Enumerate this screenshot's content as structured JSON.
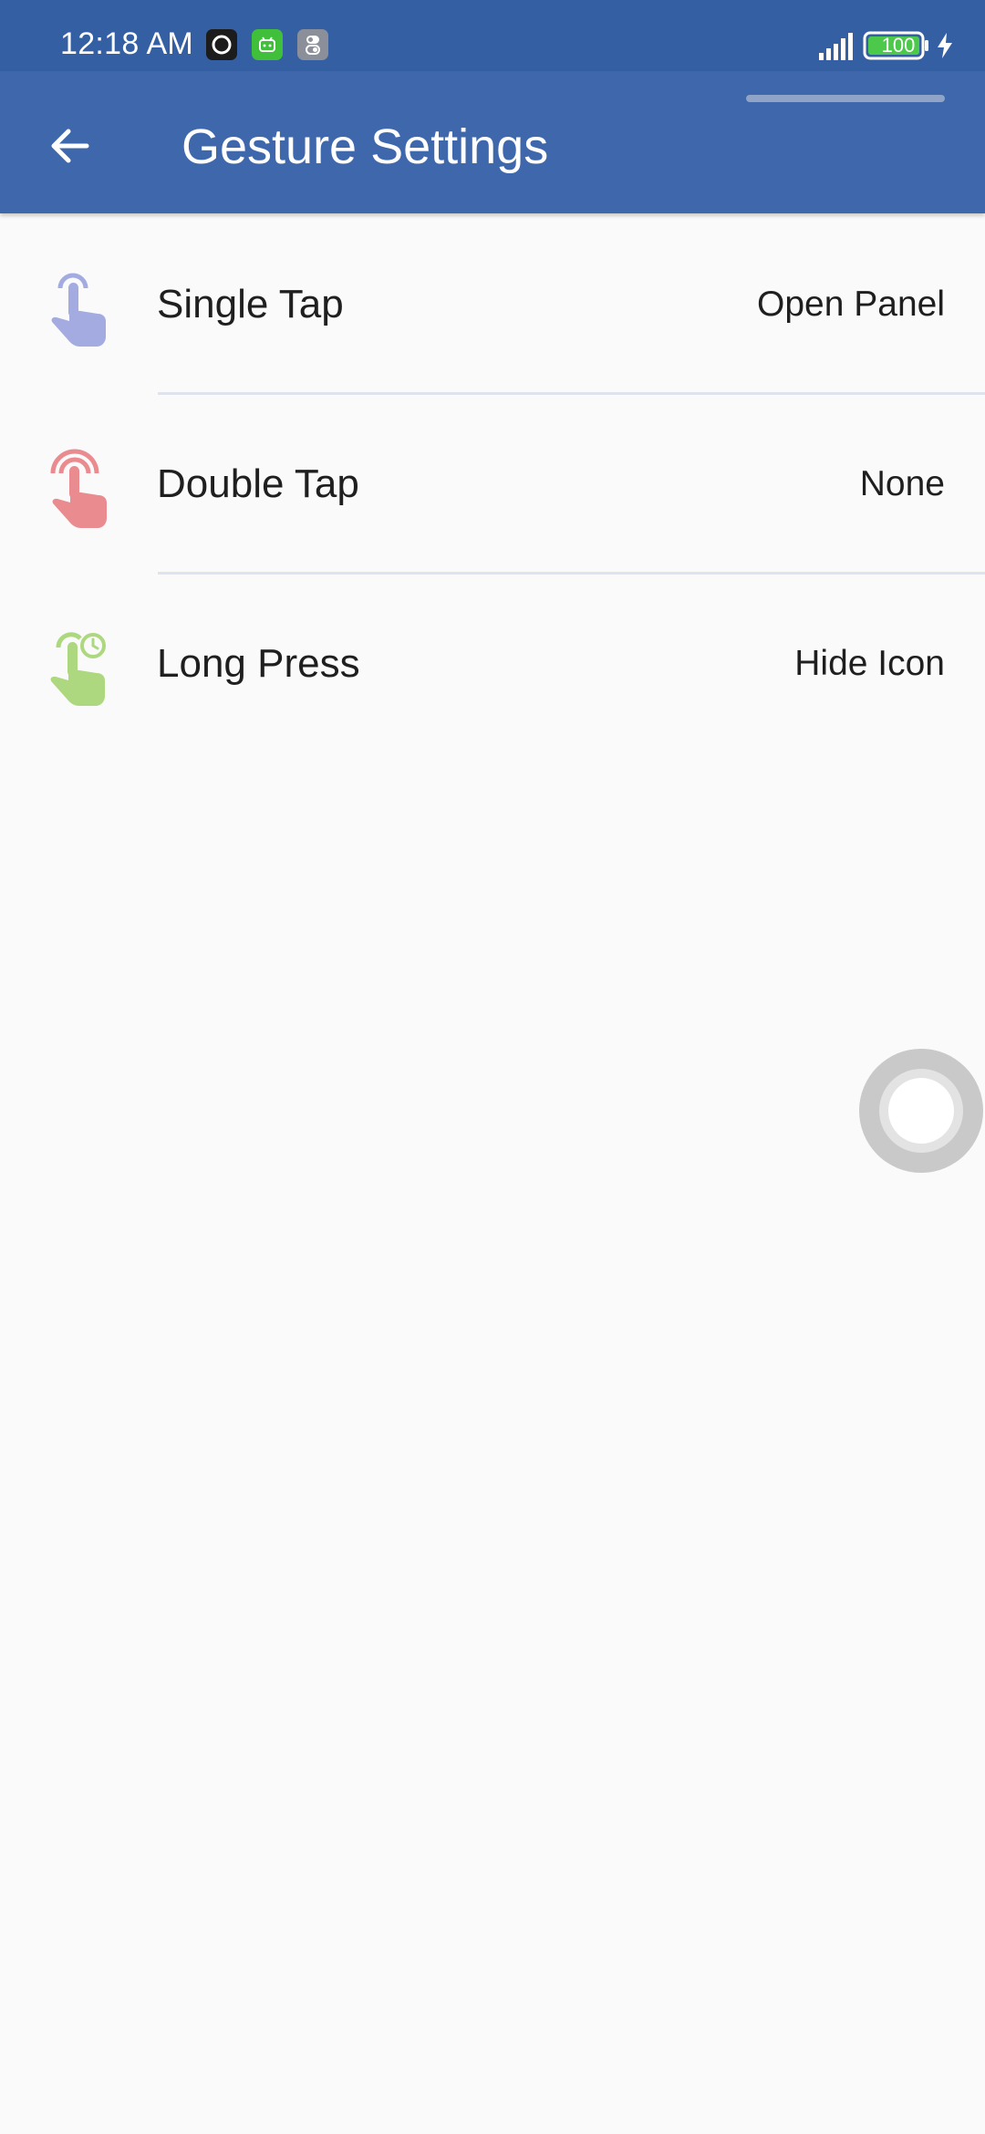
{
  "status_bar": {
    "time": "12:18 AM",
    "notification_icons": [
      "record-icon",
      "android-robot-icon",
      "toggle-settings-icon"
    ],
    "battery_level": "100",
    "signal": "signal-bars-icon",
    "charging": "charging-bolt-icon"
  },
  "app_bar": {
    "title": "Gesture Settings",
    "back_icon": "arrow-left-icon",
    "color": "#3e67ac"
  },
  "gestures": [
    {
      "label": "Single Tap",
      "value": "Open Panel",
      "icon": "single-tap-icon",
      "color": "#a3abe0"
    },
    {
      "label": "Double Tap",
      "value": "None",
      "icon": "double-tap-icon",
      "color": "#ea8b90"
    },
    {
      "label": "Long Press",
      "value": "Hide Icon",
      "icon": "long-press-icon",
      "color": "#aed87f"
    }
  ],
  "floating_button": {
    "icon": "assistive-touch-icon"
  },
  "colors": {
    "status_bar": "#345fa3",
    "background": "#fafafa",
    "divider": "#dfe2ef"
  }
}
